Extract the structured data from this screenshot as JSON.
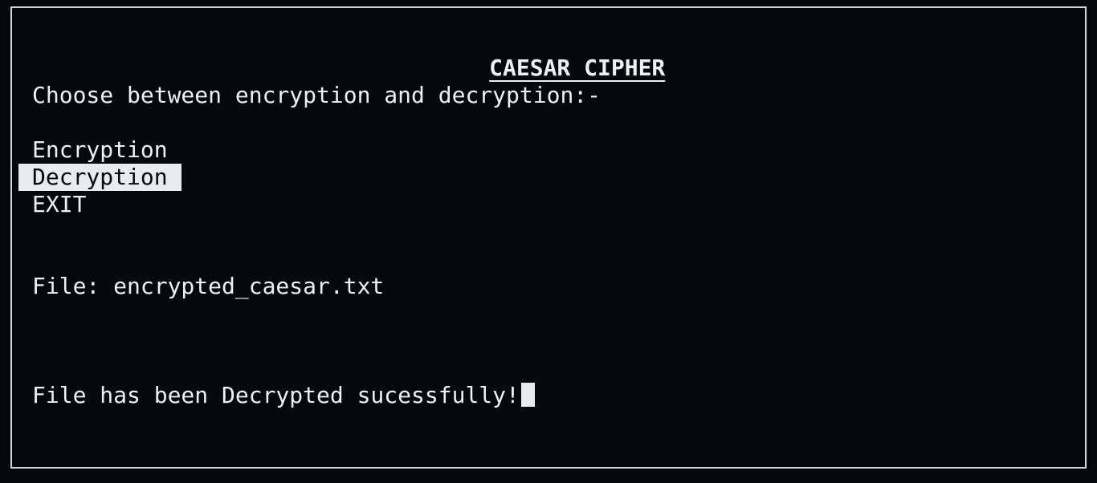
{
  "title": "CAESAR CIPHER",
  "prompt": "Choose between encryption and decryption:-",
  "menu": {
    "items": [
      "Encryption",
      "Decryption",
      "EXIT"
    ],
    "selected": "Decryption"
  },
  "file_line": "File: encrypted_caesar.txt",
  "status": "File has been Decrypted sucessfully!",
  "colors": {
    "background": "#05080d",
    "foreground": "#eef0f3",
    "highlight": "#e8ebef"
  }
}
